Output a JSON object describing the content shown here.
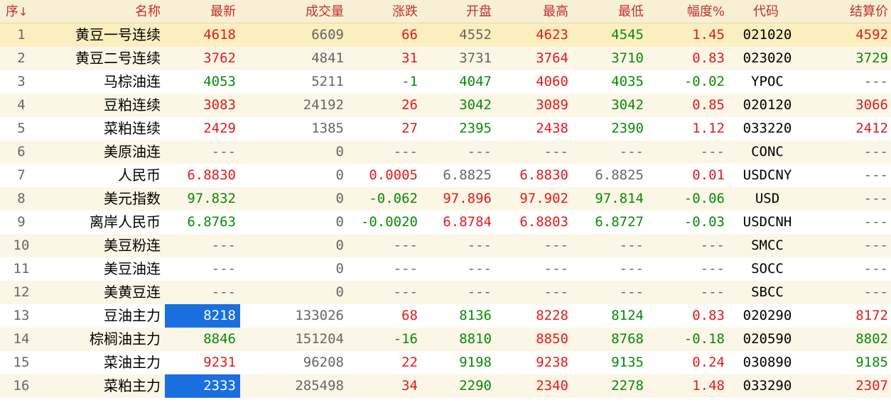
{
  "colors": {
    "up": "#e21b1b",
    "down": "#0a8a0a",
    "neutral": "#666666",
    "header_text": "#c03030",
    "highlight": "#1a6fe0"
  },
  "header": {
    "seq": "序",
    "sort_icon": "arrow-down-icon",
    "sort_glyph": "↓",
    "name": "名称",
    "last": "最新",
    "volume": "成交量",
    "change": "涨跌",
    "open": "开盘",
    "high": "最高",
    "low": "最低",
    "pct": "幅度%",
    "code": "代码",
    "settle": "结算价"
  },
  "rows": [
    {
      "seq": "1",
      "name": "黄豆一号连续",
      "last": "4618",
      "volume": "6609",
      "change": "66",
      "open": "4552",
      "high": "4623",
      "low": "4545",
      "pct": "1.45",
      "code": "021020",
      "settle": "4592"
    },
    {
      "seq": "2",
      "name": "黄豆二号连续",
      "last": "3762",
      "volume": "4841",
      "change": "31",
      "open": "3731",
      "high": "3764",
      "low": "3710",
      "pct": "0.83",
      "code": "023020",
      "settle": "3729"
    },
    {
      "seq": "3",
      "name": "马棕油连",
      "last": "4053",
      "volume": "5211",
      "change": "-1",
      "open": "4047",
      "high": "4060",
      "low": "4035",
      "pct": "-0.02",
      "code": "YPOC",
      "settle": "---"
    },
    {
      "seq": "4",
      "name": "豆粕连续",
      "last": "3083",
      "volume": "24192",
      "change": "26",
      "open": "3042",
      "high": "3089",
      "low": "3042",
      "pct": "0.85",
      "code": "020120",
      "settle": "3066"
    },
    {
      "seq": "5",
      "name": "菜粕连续",
      "last": "2429",
      "volume": "1385",
      "change": "27",
      "open": "2395",
      "high": "2438",
      "low": "2390",
      "pct": "1.12",
      "code": "033220",
      "settle": "2412"
    },
    {
      "seq": "6",
      "name": "美原油连",
      "last": "---",
      "volume": "0",
      "change": "---",
      "open": "---",
      "high": "---",
      "low": "---",
      "pct": "---",
      "code": "CONC",
      "settle": "---"
    },
    {
      "seq": "7",
      "name": "人民币",
      "last": "6.8830",
      "volume": "0",
      "change": "0.0005",
      "open": "6.8825",
      "high": "6.8830",
      "low": "6.8825",
      "pct": "0.01",
      "code": "USDCNY",
      "settle": "---"
    },
    {
      "seq": "8",
      "name": "美元指数",
      "last": "97.832",
      "volume": "0",
      "change": "-0.062",
      "open": "97.896",
      "high": "97.902",
      "low": "97.814",
      "pct": "-0.06",
      "code": "USD",
      "settle": "---"
    },
    {
      "seq": "9",
      "name": "离岸人民币",
      "last": "6.8763",
      "volume": "0",
      "change": "-0.0020",
      "open": "6.8784",
      "high": "6.8803",
      "low": "6.8727",
      "pct": "-0.03",
      "code": "USDCNH",
      "settle": "---"
    },
    {
      "seq": "10",
      "name": "美豆粉连",
      "last": "---",
      "volume": "0",
      "change": "---",
      "open": "---",
      "high": "---",
      "low": "---",
      "pct": "---",
      "code": "SMCC",
      "settle": "---"
    },
    {
      "seq": "11",
      "name": "美豆油连",
      "last": "---",
      "volume": "0",
      "change": "---",
      "open": "---",
      "high": "---",
      "low": "---",
      "pct": "---",
      "code": "SOCC",
      "settle": "---"
    },
    {
      "seq": "12",
      "name": "美黄豆连",
      "last": "---",
      "volume": "0",
      "change": "---",
      "open": "---",
      "high": "---",
      "low": "---",
      "pct": "---",
      "code": "SBCC",
      "settle": "---"
    },
    {
      "seq": "13",
      "name": "豆油主力",
      "last": "8218",
      "volume": "133026",
      "change": "68",
      "open": "8136",
      "high": "8228",
      "low": "8124",
      "pct": "0.83",
      "code": "020290",
      "settle": "8172"
    },
    {
      "seq": "14",
      "name": "棕榈油主力",
      "last": "8846",
      "volume": "151204",
      "change": "-16",
      "open": "8810",
      "high": "8850",
      "low": "8768",
      "pct": "-0.18",
      "code": "020590",
      "settle": "8802"
    },
    {
      "seq": "15",
      "name": "菜油主力",
      "last": "9231",
      "volume": "96208",
      "change": "22",
      "open": "9198",
      "high": "9238",
      "low": "9135",
      "pct": "0.24",
      "code": "030890",
      "settle": "9185"
    },
    {
      "seq": "16",
      "name": "菜粕主力",
      "last": "2333",
      "volume": "285498",
      "change": "34",
      "open": "2290",
      "high": "2340",
      "low": "2278",
      "pct": "1.48",
      "code": "033290",
      "settle": "2307"
    }
  ],
  "cell_colors": [
    {
      "last": "red",
      "change": "red",
      "open": "gray",
      "high": "red",
      "low": "green",
      "pct": "red",
      "settle": "red"
    },
    {
      "last": "red",
      "change": "red",
      "open": "gray",
      "high": "red",
      "low": "green",
      "pct": "red",
      "settle": "green"
    },
    {
      "last": "green",
      "change": "green",
      "open": "green",
      "high": "red",
      "low": "green",
      "pct": "green",
      "settle": "gray"
    },
    {
      "last": "red",
      "change": "red",
      "open": "green",
      "high": "red",
      "low": "green",
      "pct": "red",
      "settle": "red"
    },
    {
      "last": "red",
      "change": "red",
      "open": "green",
      "high": "red",
      "low": "green",
      "pct": "red",
      "settle": "red"
    },
    {
      "last": "gray",
      "change": "gray",
      "open": "gray",
      "high": "gray",
      "low": "gray",
      "pct": "gray",
      "settle": "gray"
    },
    {
      "last": "red",
      "change": "red",
      "open": "gray",
      "high": "red",
      "low": "gray",
      "pct": "red",
      "settle": "gray"
    },
    {
      "last": "green",
      "change": "green",
      "open": "red",
      "high": "red",
      "low": "green",
      "pct": "green",
      "settle": "gray"
    },
    {
      "last": "green",
      "change": "green",
      "open": "red",
      "high": "red",
      "low": "green",
      "pct": "green",
      "settle": "gray"
    },
    {
      "last": "gray",
      "change": "gray",
      "open": "gray",
      "high": "gray",
      "low": "gray",
      "pct": "gray",
      "settle": "gray"
    },
    {
      "last": "gray",
      "change": "gray",
      "open": "gray",
      "high": "gray",
      "low": "gray",
      "pct": "gray",
      "settle": "gray"
    },
    {
      "last": "gray",
      "change": "gray",
      "open": "gray",
      "high": "gray",
      "low": "gray",
      "pct": "gray",
      "settle": "gray"
    },
    {
      "last": "hl",
      "change": "red",
      "open": "green",
      "high": "red",
      "low": "green",
      "pct": "red",
      "settle": "red"
    },
    {
      "last": "green",
      "change": "green",
      "open": "green",
      "high": "red",
      "low": "green",
      "pct": "green",
      "settle": "green"
    },
    {
      "last": "red",
      "change": "red",
      "open": "green",
      "high": "red",
      "low": "green",
      "pct": "red",
      "settle": "green"
    },
    {
      "last": "hl",
      "change": "red",
      "open": "green",
      "high": "red",
      "low": "green",
      "pct": "red",
      "settle": "red"
    }
  ],
  "selected_row": 0
}
